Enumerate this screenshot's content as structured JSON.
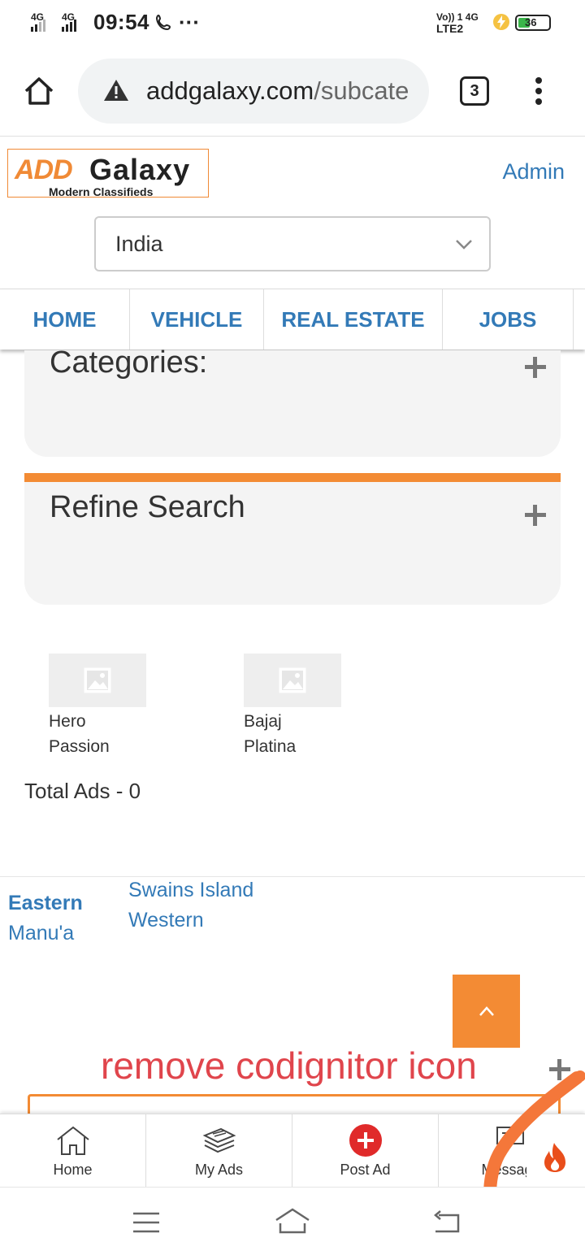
{
  "status_bar": {
    "time": "09:54",
    "sig1": "4G",
    "sig2": "4G",
    "dots": "···",
    "right_top": "Vo)) 1  4G",
    "right_bottom": "LTE2",
    "battery": "36"
  },
  "browser": {
    "url_main": "addgalaxy.com",
    "url_path": "/subcate",
    "tab_count": "3"
  },
  "site": {
    "logo_add": "ADD",
    "logo_galaxy": "Galaxy",
    "logo_tagline": "Modern Classifieds",
    "admin_link": "Admin",
    "country_selected": "India"
  },
  "nav": {
    "items": [
      {
        "label": "HOME"
      },
      {
        "label": "VEHICLE"
      },
      {
        "label": "REAL ESTATE"
      },
      {
        "label": "JOBS"
      }
    ]
  },
  "panels": {
    "categories_title": "Categories:",
    "refine_title": "Refine Search"
  },
  "items": [
    {
      "name_line1": "Hero",
      "name_line2": "Passion"
    },
    {
      "name_line1": "Bajaj",
      "name_line2": "Platina"
    }
  ],
  "total_ads": "Total Ads - 0",
  "regions": {
    "col1_title": "Eastern",
    "col1_sub": "Manu'a",
    "col2_a": "Swains Island",
    "col2_b": "Western"
  },
  "annotation": "remove codignitor icon",
  "app_nav": {
    "home": "Home",
    "my_ads": "My Ads",
    "post_ad": "Post Ad",
    "messages": "Messag"
  },
  "colors": {
    "brand_orange": "#f38b34",
    "link_blue": "#337ab7",
    "post_red": "#e02a2a",
    "annotation_red": "#e0454c"
  }
}
